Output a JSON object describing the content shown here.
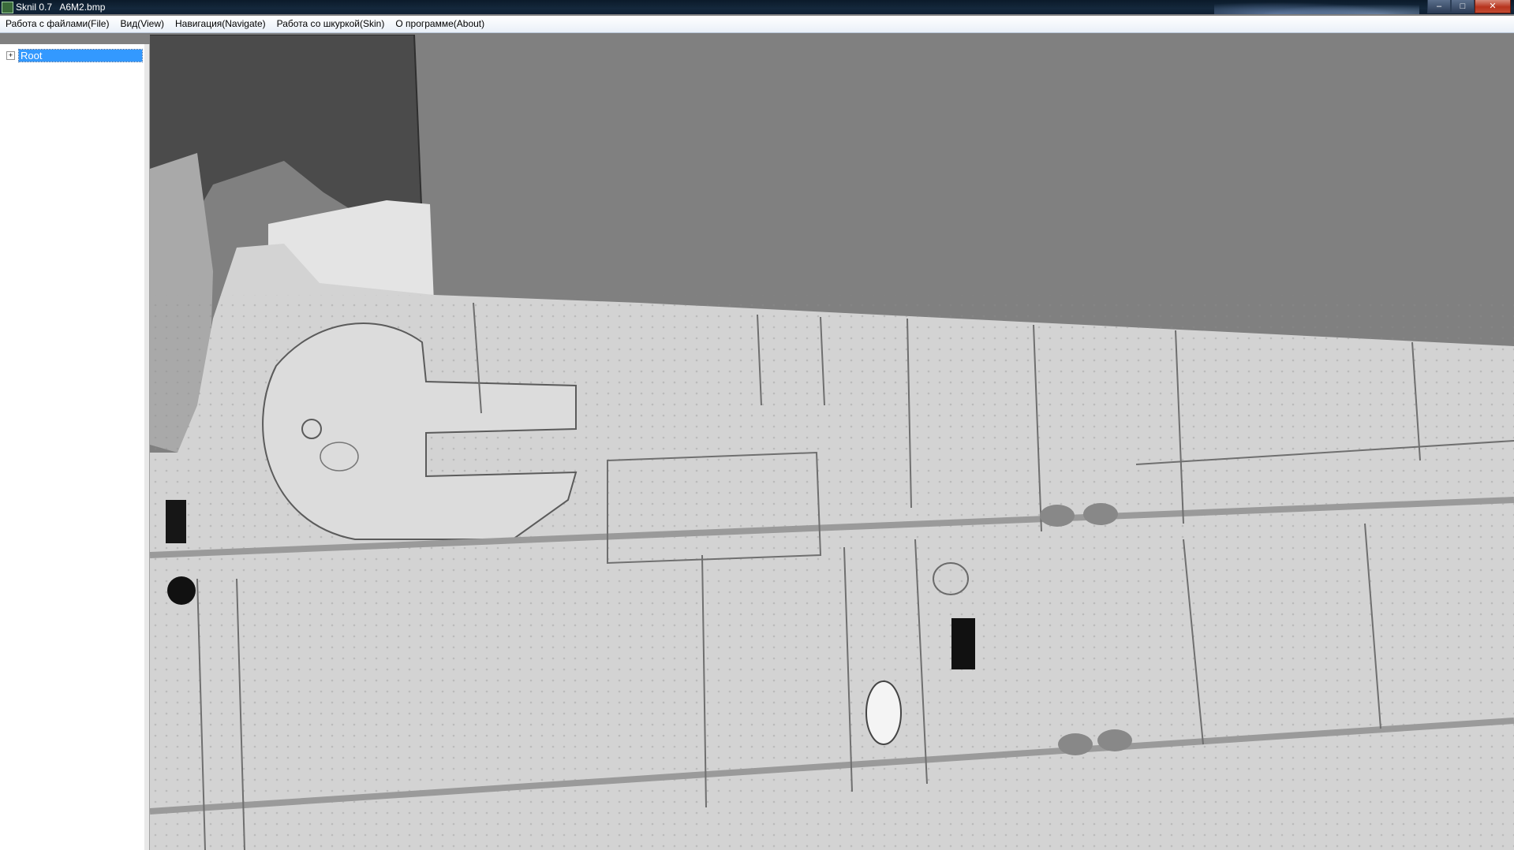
{
  "window": {
    "title": "Sknil 0.7   A6M2.bmp",
    "controls": {
      "minimize": "–",
      "maximize": "□",
      "close": "✕"
    }
  },
  "menu": [
    {
      "label": "Работа с файлами(File)"
    },
    {
      "label": "Вид(View)"
    },
    {
      "label": "Навигация(Navigate)"
    },
    {
      "label": "Работа со шкуркой(Skin)"
    },
    {
      "label": "О программе(About)"
    }
  ],
  "tree": {
    "root": {
      "label": "Root",
      "expander": "+"
    }
  },
  "viewport": {
    "background_color": "#808080",
    "texture_color": "#d3d3d3"
  }
}
